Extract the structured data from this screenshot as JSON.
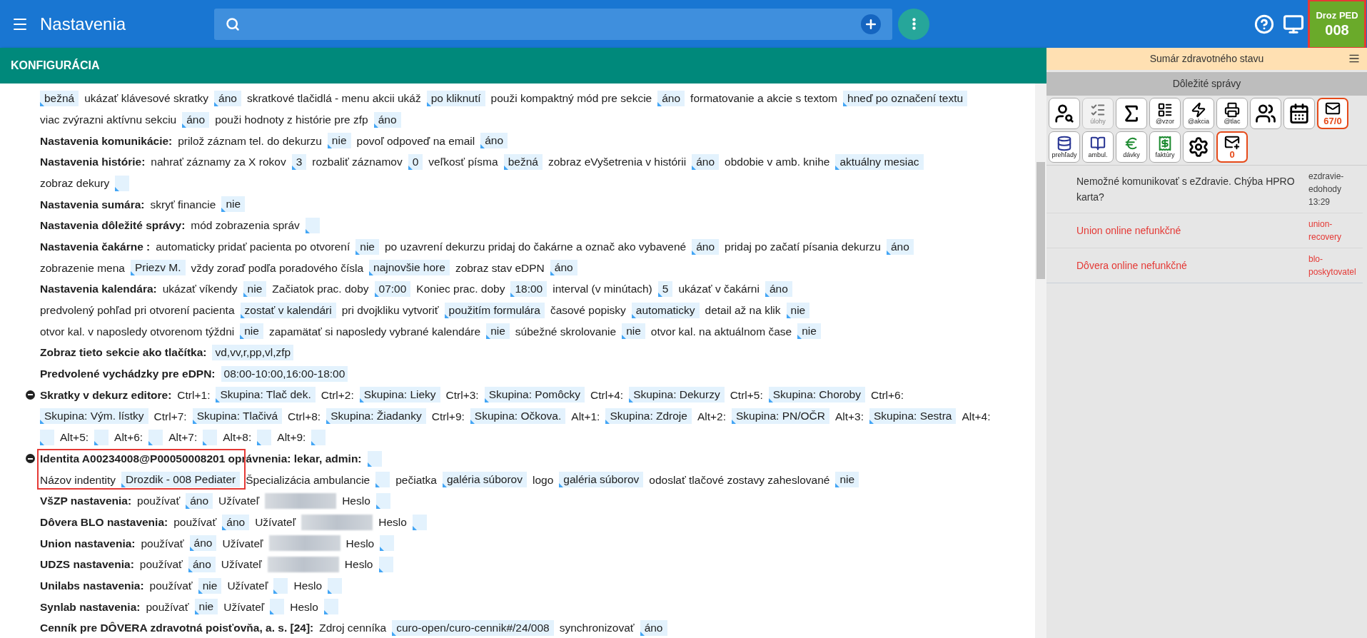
{
  "header": {
    "title": "Nastavenia"
  },
  "section_title": "KONFIGURÁCIA",
  "lines": [
    {
      "collapsible": false,
      "highlighted": false,
      "segments": [
        {
          "kind": "value",
          "text": "bežná"
        },
        {
          "kind": "text",
          "text": "ukázať klávesové skratky"
        },
        {
          "kind": "value",
          "text": "áno"
        },
        {
          "kind": "text",
          "text": "skratkové tlačidlá - menu akcii ukáž"
        },
        {
          "kind": "value",
          "text": "po kliknutí"
        },
        {
          "kind": "text",
          "text": "použi kompaktný mód pre sekcie"
        },
        {
          "kind": "value",
          "text": "áno"
        },
        {
          "kind": "text",
          "text": "formatovanie a akcie s textom"
        },
        {
          "kind": "value",
          "text": "hneď po označení textu"
        }
      ]
    },
    {
      "collapsible": false,
      "highlighted": false,
      "segments": [
        {
          "kind": "text",
          "text": "viac zvýrazni aktívnu sekciu"
        },
        {
          "kind": "value",
          "text": "áno"
        },
        {
          "kind": "text",
          "text": "použi hodnoty z histórie pre zfp"
        },
        {
          "kind": "value",
          "text": "áno"
        }
      ]
    },
    {
      "collapsible": false,
      "highlighted": false,
      "segments": [
        {
          "kind": "label",
          "text": "Nastavenia komunikácie:"
        },
        {
          "kind": "text",
          "text": "prilož záznam tel. do dekurzu"
        },
        {
          "kind": "value",
          "text": "nie"
        },
        {
          "kind": "text",
          "text": "povoľ odpoveď na email"
        },
        {
          "kind": "value",
          "text": "áno"
        }
      ]
    },
    {
      "collapsible": false,
      "highlighted": false,
      "segments": [
        {
          "kind": "label",
          "text": "Nastavenia histórie:"
        },
        {
          "kind": "text",
          "text": "nahrať záznamy za X rokov"
        },
        {
          "kind": "value",
          "text": "3"
        },
        {
          "kind": "text",
          "text": "rozbaliť záznamov"
        },
        {
          "kind": "value",
          "text": "0"
        },
        {
          "kind": "text",
          "text": "veľkosť písma"
        },
        {
          "kind": "value",
          "text": "bežná"
        },
        {
          "kind": "text",
          "text": "zobraz eVyšetrenia v histórii"
        },
        {
          "kind": "value",
          "text": "áno"
        },
        {
          "kind": "text",
          "text": "obdobie v amb. knihe"
        },
        {
          "kind": "value",
          "text": "aktuálny mesiac"
        }
      ]
    },
    {
      "collapsible": false,
      "highlighted": false,
      "segments": [
        {
          "kind": "text",
          "text": "zobraz dekury"
        },
        {
          "kind": "empty"
        }
      ]
    },
    {
      "collapsible": false,
      "highlighted": false,
      "segments": [
        {
          "kind": "label",
          "text": "Nastavenia sumára:"
        },
        {
          "kind": "text",
          "text": "skryť financie"
        },
        {
          "kind": "value",
          "text": "nie"
        }
      ]
    },
    {
      "collapsible": false,
      "highlighted": false,
      "segments": [
        {
          "kind": "label",
          "text": "Nastavenia dôležité správy:"
        },
        {
          "kind": "text",
          "text": "mód zobrazenia správ"
        },
        {
          "kind": "empty"
        }
      ]
    },
    {
      "collapsible": false,
      "highlighted": false,
      "segments": [
        {
          "kind": "label",
          "text": "Nastavenia čakárne :"
        },
        {
          "kind": "text",
          "text": "automaticky pridať pacienta po otvorení"
        },
        {
          "kind": "value",
          "text": "nie"
        },
        {
          "kind": "text",
          "text": "po uzavrení dekurzu pridaj do čakárne a označ ako vybavené"
        },
        {
          "kind": "value",
          "text": "áno"
        },
        {
          "kind": "text",
          "text": "pridaj po začatí písania dekurzu"
        },
        {
          "kind": "value",
          "text": "áno"
        }
      ]
    },
    {
      "collapsible": false,
      "highlighted": false,
      "segments": [
        {
          "kind": "text",
          "text": "zobrazenie mena"
        },
        {
          "kind": "value",
          "text": "Priezv M."
        },
        {
          "kind": "text",
          "text": "vždy zoraď podľa poradového čísla"
        },
        {
          "kind": "value",
          "text": "najnovšie hore"
        },
        {
          "kind": "text",
          "text": "zobraz stav eDPN"
        },
        {
          "kind": "value",
          "text": "áno"
        }
      ]
    },
    {
      "collapsible": false,
      "highlighted": false,
      "segments": [
        {
          "kind": "label",
          "text": "Nastavenia kalendára:"
        },
        {
          "kind": "text",
          "text": "ukázať víkendy"
        },
        {
          "kind": "value",
          "text": "nie"
        },
        {
          "kind": "text",
          "text": "Začiatok prac. doby"
        },
        {
          "kind": "value",
          "text": "07:00"
        },
        {
          "kind": "text",
          "text": "Koniec prac. doby"
        },
        {
          "kind": "value",
          "text": "18:00"
        },
        {
          "kind": "text",
          "text": "interval (v minútach)"
        },
        {
          "kind": "value",
          "text": "5"
        },
        {
          "kind": "text",
          "text": "ukázať v čakárni"
        },
        {
          "kind": "value",
          "text": "áno"
        }
      ]
    },
    {
      "collapsible": false,
      "highlighted": false,
      "segments": [
        {
          "kind": "text",
          "text": "predvolený pohľad pri otvorení pacienta"
        },
        {
          "kind": "value",
          "text": "zostať v kalendári"
        },
        {
          "kind": "text",
          "text": "pri dvojkliku vytvoriť"
        },
        {
          "kind": "value",
          "text": "použitím formulára"
        },
        {
          "kind": "text",
          "text": "časové popisky"
        },
        {
          "kind": "value",
          "text": "automaticky"
        },
        {
          "kind": "text",
          "text": "detail až na klik"
        },
        {
          "kind": "value",
          "text": "nie"
        }
      ]
    },
    {
      "collapsible": false,
      "highlighted": false,
      "segments": [
        {
          "kind": "text",
          "text": "otvor kal. v naposledy otvorenom týždni"
        },
        {
          "kind": "value",
          "text": "nie"
        },
        {
          "kind": "text",
          "text": "zapamätať si naposledy vybrané kalendáre"
        },
        {
          "kind": "value",
          "text": "nie"
        },
        {
          "kind": "text",
          "text": "súbežné skrolovanie"
        },
        {
          "kind": "value",
          "text": "nie"
        },
        {
          "kind": "text",
          "text": "otvor kal. na aktuálnom čase"
        },
        {
          "kind": "value",
          "text": "nie"
        }
      ]
    },
    {
      "collapsible": false,
      "highlighted": false,
      "segments": [
        {
          "kind": "label",
          "text": "Zobraz tieto sekcie ako tlačítka:"
        },
        {
          "kind": "static",
          "text": "vd,vv,r,pp,vl,zfp"
        }
      ]
    },
    {
      "collapsible": false,
      "highlighted": false,
      "segments": [
        {
          "kind": "label",
          "text": "Predvolené vychádzky pre eDPN:"
        },
        {
          "kind": "static",
          "text": "08:00-10:00,16:00-18:00"
        }
      ]
    },
    {
      "collapsible": true,
      "highlighted": false,
      "segments": [
        {
          "kind": "label",
          "text": "Skratky v dekurz editore:"
        },
        {
          "kind": "text",
          "text": "Ctrl+1:"
        },
        {
          "kind": "value",
          "text": "Skupina: Tlač dek."
        },
        {
          "kind": "text",
          "text": "Ctrl+2:"
        },
        {
          "kind": "value",
          "text": "Skupina: Lieky"
        },
        {
          "kind": "text",
          "text": "Ctrl+3:"
        },
        {
          "kind": "value",
          "text": "Skupina: Pomôcky"
        },
        {
          "kind": "text",
          "text": "Ctrl+4:"
        },
        {
          "kind": "value",
          "text": "Skupina: Dekurzy"
        },
        {
          "kind": "text",
          "text": "Ctrl+5:"
        },
        {
          "kind": "value",
          "text": "Skupina: Choroby"
        },
        {
          "kind": "text",
          "text": "Ctrl+6:"
        }
      ]
    },
    {
      "collapsible": false,
      "highlighted": false,
      "segments": [
        {
          "kind": "value",
          "text": "Skupina: Vým. lístky"
        },
        {
          "kind": "text",
          "text": "Ctrl+7:"
        },
        {
          "kind": "value",
          "text": "Skupina: Tlačivá"
        },
        {
          "kind": "text",
          "text": "Ctrl+8:"
        },
        {
          "kind": "value",
          "text": "Skupina: Žiadanky"
        },
        {
          "kind": "text",
          "text": "Ctrl+9:"
        },
        {
          "kind": "value",
          "text": "Skupina: Očkova."
        },
        {
          "kind": "text",
          "text": "Alt+1:"
        },
        {
          "kind": "value",
          "text": "Skupina: Zdroje"
        },
        {
          "kind": "text",
          "text": "Alt+2:"
        },
        {
          "kind": "value",
          "text": "Skupina: PN/OČR"
        },
        {
          "kind": "text",
          "text": "Alt+3:"
        },
        {
          "kind": "value",
          "text": "Skupina: Sestra"
        },
        {
          "kind": "text",
          "text": "Alt+4:"
        }
      ]
    },
    {
      "collapsible": false,
      "highlighted": false,
      "segments": [
        {
          "kind": "empty"
        },
        {
          "kind": "text",
          "text": "Alt+5:"
        },
        {
          "kind": "empty"
        },
        {
          "kind": "text",
          "text": "Alt+6:"
        },
        {
          "kind": "empty"
        },
        {
          "kind": "text",
          "text": "Alt+7:"
        },
        {
          "kind": "empty"
        },
        {
          "kind": "text",
          "text": "Alt+8:"
        },
        {
          "kind": "empty"
        },
        {
          "kind": "text",
          "text": "Alt+9:"
        },
        {
          "kind": "empty"
        }
      ]
    },
    {
      "collapsible": true,
      "highlighted": true,
      "segments": [
        {
          "kind": "label",
          "text": "Identita A00234008@P00050008201 oprávnenia: lekar, admin:"
        },
        {
          "kind": "empty"
        }
      ]
    },
    {
      "collapsible": false,
      "highlighted": true,
      "segments": [
        {
          "kind": "text",
          "text": "Názov indentity"
        },
        {
          "kind": "value",
          "text": "Drozdik - 008 Pediater"
        },
        {
          "kind": "text",
          "text": "Špecializácia ambulancie"
        },
        {
          "kind": "empty"
        },
        {
          "kind": "text",
          "text": "pečiatka"
        },
        {
          "kind": "value",
          "text": "galéria súborov"
        },
        {
          "kind": "text",
          "text": "logo"
        },
        {
          "kind": "value",
          "text": "galéria súborov"
        },
        {
          "kind": "text",
          "text": "odoslať tlačové zostavy zaheslované"
        },
        {
          "kind": "value",
          "text": "nie"
        }
      ]
    },
    {
      "collapsible": false,
      "highlighted": false,
      "segments": [
        {
          "kind": "label",
          "text": "VšZP nastavenia:"
        },
        {
          "kind": "text",
          "text": "používať"
        },
        {
          "kind": "value",
          "text": "áno"
        },
        {
          "kind": "text",
          "text": "Užívateľ"
        },
        {
          "kind": "blurred"
        },
        {
          "kind": "text",
          "text": "Heslo"
        },
        {
          "kind": "empty"
        }
      ]
    },
    {
      "collapsible": false,
      "highlighted": false,
      "segments": [
        {
          "kind": "label",
          "text": "Dôvera BLO nastavenia:"
        },
        {
          "kind": "text",
          "text": "používať"
        },
        {
          "kind": "value",
          "text": "áno"
        },
        {
          "kind": "text",
          "text": "Užívateľ"
        },
        {
          "kind": "blurred"
        },
        {
          "kind": "text",
          "text": "Heslo"
        },
        {
          "kind": "empty"
        }
      ]
    },
    {
      "collapsible": false,
      "highlighted": false,
      "segments": [
        {
          "kind": "label",
          "text": "Union nastavenia:"
        },
        {
          "kind": "text",
          "text": "používať"
        },
        {
          "kind": "value",
          "text": "áno"
        },
        {
          "kind": "text",
          "text": "Užívateľ"
        },
        {
          "kind": "blurred"
        },
        {
          "kind": "text",
          "text": "Heslo"
        },
        {
          "kind": "empty"
        }
      ]
    },
    {
      "collapsible": false,
      "highlighted": false,
      "segments": [
        {
          "kind": "label",
          "text": "UDZS nastavenia:"
        },
        {
          "kind": "text",
          "text": "používať"
        },
        {
          "kind": "value",
          "text": "áno"
        },
        {
          "kind": "text",
          "text": "Užívateľ"
        },
        {
          "kind": "blurred"
        },
        {
          "kind": "text",
          "text": "Heslo"
        },
        {
          "kind": "empty"
        }
      ]
    },
    {
      "collapsible": false,
      "highlighted": false,
      "segments": [
        {
          "kind": "label",
          "text": "Unilabs nastavenia:"
        },
        {
          "kind": "text",
          "text": "používať"
        },
        {
          "kind": "value",
          "text": "nie"
        },
        {
          "kind": "text",
          "text": "Užívateľ"
        },
        {
          "kind": "empty"
        },
        {
          "kind": "text",
          "text": "Heslo"
        },
        {
          "kind": "empty"
        }
      ]
    },
    {
      "collapsible": false,
      "highlighted": false,
      "segments": [
        {
          "kind": "label",
          "text": "Synlab nastavenia:"
        },
        {
          "kind": "text",
          "text": "používať"
        },
        {
          "kind": "value",
          "text": "nie"
        },
        {
          "kind": "text",
          "text": "Užívateľ"
        },
        {
          "kind": "empty"
        },
        {
          "kind": "text",
          "text": "Heslo"
        },
        {
          "kind": "empty"
        }
      ]
    },
    {
      "collapsible": false,
      "highlighted": false,
      "segments": [
        {
          "kind": "label",
          "text": "Cenník pre DÔVERA zdravotná poisťovňa, a. s. [24]:"
        },
        {
          "kind": "text",
          "text": "Zdroj cenníka"
        },
        {
          "kind": "value",
          "text": "curo-open/curo-cennik#/24/008"
        },
        {
          "kind": "text",
          "text": "synchronizovať"
        },
        {
          "kind": "value",
          "text": "áno"
        }
      ]
    }
  ],
  "side_panel": {
    "summary_title": "Sumár zdravotného stavu",
    "messages_title": "Dôležité správy",
    "tools": [
      {
        "disabled": false
      },
      {
        "label": "úlohy",
        "disabled": true
      },
      {
        "disabled": false
      },
      {
        "label": "@vzor",
        "disabled": false
      },
      {
        "label": "@akcia",
        "disabled": false
      },
      {
        "label": "@tlac",
        "disabled": false
      },
      {
        "disabled": false
      },
      {
        "disabled": false
      },
      {
        "count": "67/0",
        "disabled": false
      },
      {
        "label": "prehľady",
        "disabled": false
      },
      {
        "label": "ambul.",
        "disabled": false
      },
      {
        "label": "dávky",
        "disabled": false
      },
      {
        "label": "faktúry",
        "disabled": false
      },
      {
        "disabled": false
      },
      {
        "count": "0",
        "disabled": false
      }
    ],
    "messages": [
      {
        "text": "Nemožné komunikovať s eZdravie. Chýba HPRO karta?",
        "source": "ezdravie-edohody",
        "time": "13:29",
        "error": false
      },
      {
        "text": "Union online nefunkčné",
        "source": "union-recovery",
        "error": true
      },
      {
        "text": "Dôvera online nefunkčné",
        "source": "blo-poskytovatel",
        "error": true
      }
    ]
  },
  "user_badge": {
    "name": "Droz PED",
    "code": "008",
    "highlighted": true
  }
}
